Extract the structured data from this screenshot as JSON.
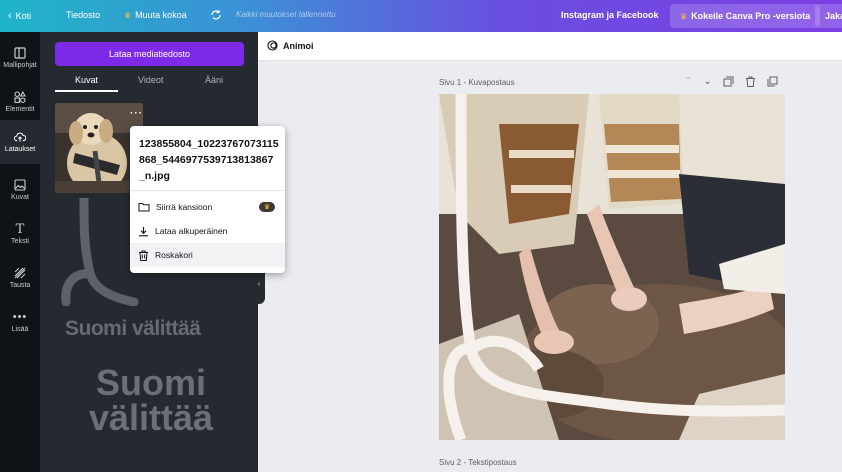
{
  "topbar": {
    "back_label": "Koti",
    "file_label": "Tiedosto",
    "resize_label": "Muuta kokoa",
    "saved_status": "Kaikki muutokset tallennettu",
    "share_target_label": "Instagram ja Facebook",
    "pro_label": "Kokeile Canva Pro -versiota",
    "share_label": "Jaka"
  },
  "rail": {
    "items": [
      {
        "label": "Mallipohjat",
        "icon": "templates-icon"
      },
      {
        "label": "Elementit",
        "icon": "elements-icon"
      },
      {
        "label": "Lataukset",
        "icon": "upload-cloud-icon",
        "active": true
      },
      {
        "label": "Kuvat",
        "icon": "image-icon"
      },
      {
        "label": "Teksti",
        "icon": "text-icon"
      },
      {
        "label": "Tausta",
        "icon": "background-icon"
      },
      {
        "label": "Lisää",
        "icon": "more-icon"
      }
    ]
  },
  "panel": {
    "upload_button": "Lataa mediatiedosto",
    "tabs": [
      "Kuvat",
      "Videot",
      "Ääni"
    ],
    "active_tab": "Kuvat",
    "brand_text_small": "Suomi välittää",
    "brand_text_large_line1": "Suomi",
    "brand_text_large_line2": "välittää"
  },
  "context_menu": {
    "filename": "123855804_10223767073115868_5446977539713813867_n.jpg",
    "items": [
      {
        "label": "Siirrä kansioon",
        "icon": "folder-icon",
        "pro": true
      },
      {
        "label": "Lataa alkuperäinen",
        "icon": "download-icon"
      },
      {
        "label": "Roskakori",
        "icon": "trash-icon"
      }
    ]
  },
  "editor": {
    "animate_label": "Animoi",
    "page1_label": "Sivu 1 - Kuvapostaus",
    "page2_label": "Sivu 2 - Tekstipostaus"
  },
  "colors": {
    "primary_purple": "#7d2ae8",
    "rail_bg": "#0e1318",
    "panel_bg": "#252a31",
    "canvas_bg": "#ebecf0"
  }
}
